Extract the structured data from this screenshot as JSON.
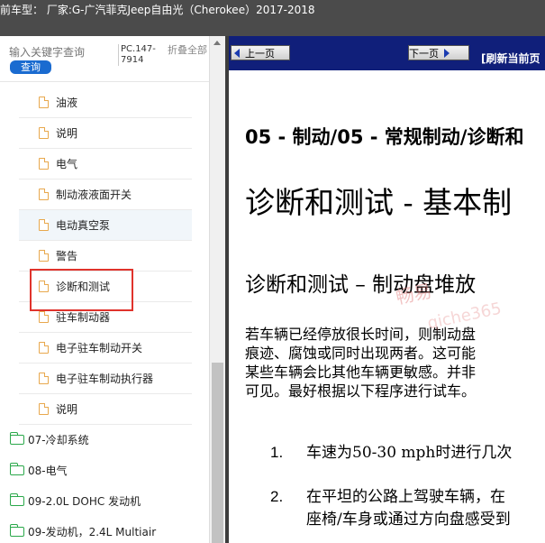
{
  "header": {
    "title": "前车型：  厂家:G-广汽菲克Jeep自由光（Cherokee）2017-2018"
  },
  "search": {
    "placeholder": "输入关键字查询",
    "button_label": "查询"
  },
  "toolbar": {
    "pc_number": "PC.147-7914",
    "collapse_all_label": "折叠全部"
  },
  "tree": {
    "sub_items": [
      {
        "label": "油液"
      },
      {
        "label": "说明"
      },
      {
        "label": "电气"
      },
      {
        "label": "制动液液面开关"
      },
      {
        "label": "电动真空泵"
      },
      {
        "label": "警告"
      },
      {
        "label": "诊断和测试"
      },
      {
        "label": "驻车制动器"
      },
      {
        "label": "电子驻车制动开关"
      },
      {
        "label": "电子驻车制动执行器"
      },
      {
        "label": "说明"
      }
    ],
    "folders": [
      {
        "label": "07-冷却系统"
      },
      {
        "label": "08-电气"
      },
      {
        "label": "09-2.0L DOHC 发动机"
      },
      {
        "label": "09-发动机，2.4L Multiair"
      }
    ]
  },
  "nav": {
    "prev_label": "上一页",
    "next_label": "下一页",
    "refresh_label": "[刷新当前页"
  },
  "doc": {
    "section_title": "05 - 制动/05 - 常规制动/诊断和",
    "main_heading": "诊断和测试  - 基本制",
    "sub_heading": "诊断和测试   –   制动盘堆放",
    "paragraph_lines": [
      "若车辆已经停放很长时间，则制动盘",
      "痕迹、腐蚀或同时出现两者。这可能",
      "某些车辆会比其他车辆更敏感。并非",
      "可见。最好根据以下程序进行试车。"
    ],
    "steps": [
      {
        "num": "1.",
        "lines": [
          "车速为50-30 mph时进行几次"
        ]
      },
      {
        "num": "2.",
        "lines": [
          "在平坦的公路上驾驶车辆，在",
          "座椅/车身或通过方向盘感受到"
        ]
      }
    ]
  },
  "watermark": {
    "line1": "畅易",
    "line2": "qiche365"
  },
  "colors": {
    "nav_bar": "#101f7a",
    "title_bar": "#4b4b4b",
    "search_button": "#1a6bd0",
    "highlight_box": "#e0332c",
    "folder_icon": "#2aa84a",
    "file_icon": "#e8a84d"
  }
}
